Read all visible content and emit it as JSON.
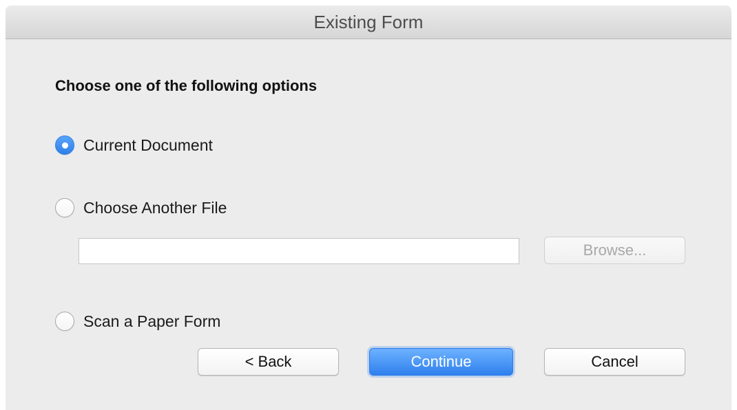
{
  "window": {
    "title": "Existing Form"
  },
  "form": {
    "heading": "Choose one of the following options",
    "options": [
      {
        "label": "Current Document",
        "selected": true
      },
      {
        "label": "Choose Another File",
        "selected": false
      },
      {
        "label": "Scan a Paper Form",
        "selected": false
      }
    ],
    "file_path_value": "",
    "browse_label": "Browse..."
  },
  "buttons": {
    "back_label": "< Back",
    "continue_label": "Continue",
    "cancel_label": "Cancel"
  },
  "colors": {
    "accent": "#2f80ee",
    "window_bg": "#ececec"
  }
}
